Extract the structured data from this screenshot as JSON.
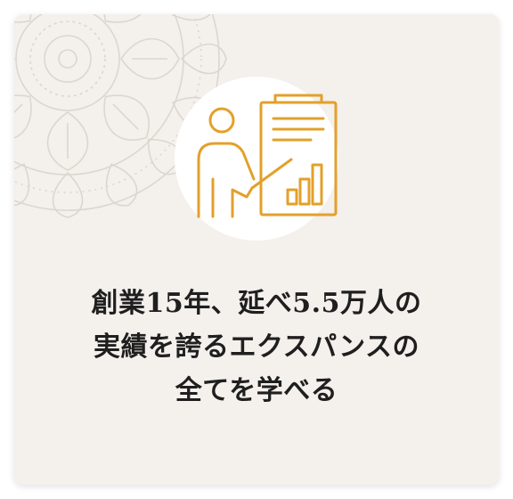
{
  "headline": {
    "line1": "創業15年、延べ5.5万人の",
    "line2": "実績を誇るエクスパンスの",
    "line3": "全てを学べる"
  },
  "colors": {
    "card_background": "#f4f0ec",
    "icon_accent": "#e3a02a",
    "text": "#1f1f1f",
    "ornament": "#ddd6cf"
  },
  "icons": {
    "illustration": "presenter-chart-icon",
    "ornament": "mandala-ornament-icon"
  }
}
